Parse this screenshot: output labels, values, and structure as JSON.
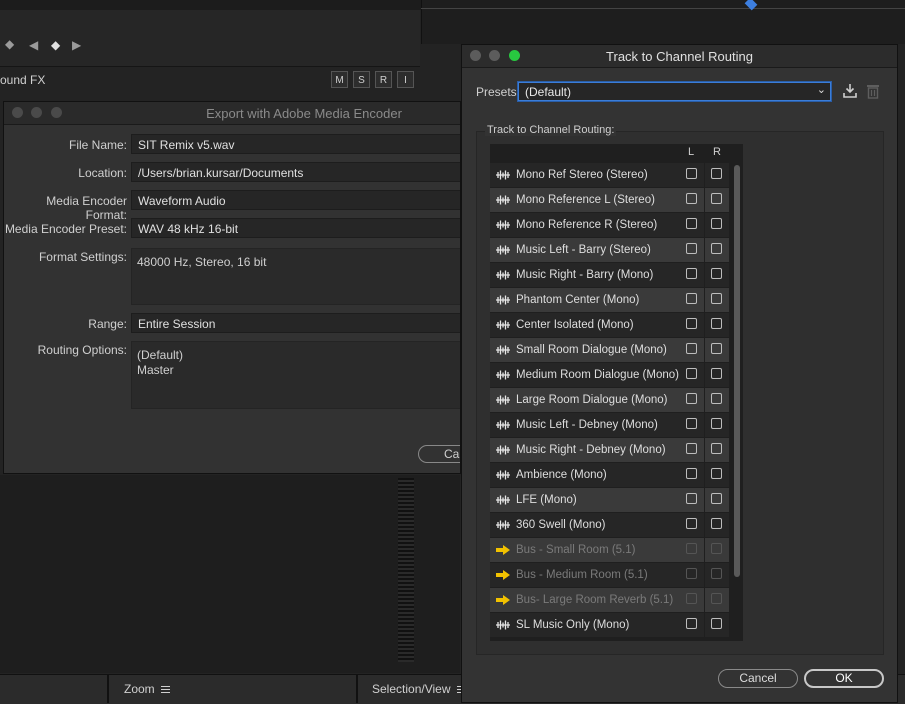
{
  "background": {
    "track_name": "ound FX",
    "mute": "M",
    "solo": "S",
    "record": "R",
    "input": "I",
    "bottom_bar": {
      "zoom_label": "Zoom",
      "selection_label": "Selection/View"
    }
  },
  "export_dialog": {
    "title": "Export with Adobe Media Encoder",
    "fields": {
      "file_name_label": "File Name:",
      "file_name": "SIT Remix v5.wav",
      "location_label": "Location:",
      "location": "/Users/brian.kursar/Documents",
      "format_label": "Media Encoder Format:",
      "format": "Waveform Audio",
      "preset_label": "Media Encoder Preset:",
      "preset": "WAV 48 kHz 16-bit",
      "format_settings_label": "Format Settings:",
      "format_settings": "48000 Hz, Stereo, 16 bit",
      "range_label": "Range:",
      "range": "Entire Session",
      "routing_label": "Routing Options:",
      "routing_line1": "(Default)",
      "routing_line2": "Master"
    },
    "cancel_partial": "Can"
  },
  "routing_dialog": {
    "title": "Track to Channel Routing",
    "presets_label": "Presets:",
    "presets_value": "(Default)",
    "group_label": "Track to Channel Routing:",
    "columns": [
      "L",
      "R"
    ],
    "rows": [
      {
        "name": "Mono Ref Stereo (Stereo)",
        "type": "track",
        "dim": false
      },
      {
        "name": "Mono Reference L (Stereo)",
        "type": "track",
        "dim": false
      },
      {
        "name": "Mono Reference R (Stereo)",
        "type": "track",
        "dim": false
      },
      {
        "name": "Music Left - Barry (Stereo)",
        "type": "track",
        "dim": false
      },
      {
        "name": "Music Right - Barry (Mono)",
        "type": "track",
        "dim": false
      },
      {
        "name": "Phantom Center (Mono)",
        "type": "track",
        "dim": false
      },
      {
        "name": "Center Isolated (Mono)",
        "type": "track",
        "dim": false
      },
      {
        "name": "Small Room Dialogue (Mono)",
        "type": "track",
        "dim": false
      },
      {
        "name": "Medium Room Dialogue (Mono)",
        "type": "track",
        "dim": false
      },
      {
        "name": "Large Room Dialogue (Mono)",
        "type": "track",
        "dim": false
      },
      {
        "name": "Music Left - Debney (Mono)",
        "type": "track",
        "dim": false
      },
      {
        "name": "Music Right - Debney (Mono)",
        "type": "track",
        "dim": false
      },
      {
        "name": "Ambience (Mono)",
        "type": "track",
        "dim": false
      },
      {
        "name": "LFE (Mono)",
        "type": "track",
        "dim": false
      },
      {
        "name": "360 Swell (Mono)",
        "type": "track",
        "dim": false
      },
      {
        "name": "Bus - Small Room (5.1)",
        "type": "bus",
        "dim": true
      },
      {
        "name": "Bus - Medium Room (5.1)",
        "type": "bus",
        "dim": true
      },
      {
        "name": "Bus- Large Room Reverb (5.1)",
        "type": "bus",
        "dim": true
      },
      {
        "name": "SL Music Only (Mono)",
        "type": "track",
        "dim": false
      }
    ],
    "cancel_label": "Cancel",
    "ok_label": "OK",
    "colors": {
      "accent": "#3b7dd8",
      "bus_icon": "#f2c200"
    }
  }
}
